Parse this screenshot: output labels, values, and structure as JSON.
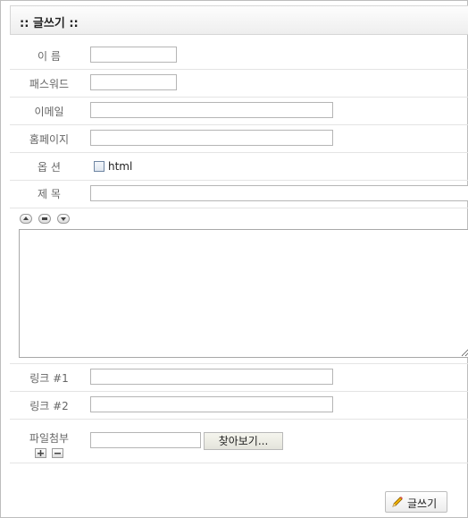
{
  "header": {
    "title": ":: 글쓰기 ::"
  },
  "form": {
    "name_label": "이 름",
    "password_label": "패스워드",
    "email_label": "이메일",
    "homepage_label": "홈페이지",
    "option_label": "옵 션",
    "html_option_label": "html",
    "subject_label": "제 목",
    "link1_label": "링크 #1",
    "link2_label": "링크 #2",
    "file_label": "파일첨부",
    "browse_label": "찾아보기..."
  },
  "footer": {
    "submit_label": "글쓰기"
  },
  "colors": {
    "border": "#bdbdbd",
    "label": "#666666",
    "row_divider": "#e4e4e4"
  },
  "icons": [
    "pencil-icon",
    "arrow-up-icon",
    "equal-icon",
    "arrow-down-icon",
    "plus-icon",
    "minus-icon"
  ]
}
